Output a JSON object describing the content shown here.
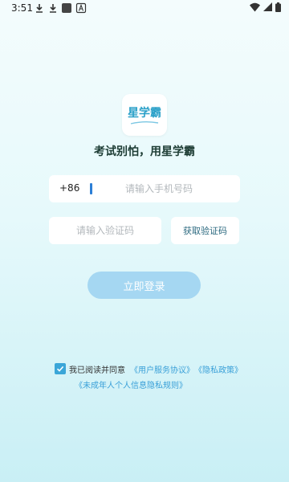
{
  "status_bar": {
    "time": "3:51"
  },
  "logo": {
    "text": "星学霸"
  },
  "slogan": "考试别怕，用星学霸",
  "phone": {
    "country_code": "+86",
    "placeholder": "请输入手机号码"
  },
  "code": {
    "placeholder": "请输入验证码",
    "get_code_label": "获取验证码"
  },
  "login_label": "立即登录",
  "agreement": {
    "prefix": "我已阅读并同意",
    "user_agreement": "《用户服务协议》",
    "privacy_policy": "《隐私政策》",
    "minor_privacy": "《未成年人个人信息隐私规则》",
    "checked": true
  },
  "colors": {
    "accent": "#3aa6d8",
    "login_button": "#a5d7f2",
    "link": "#3aa0d8"
  }
}
